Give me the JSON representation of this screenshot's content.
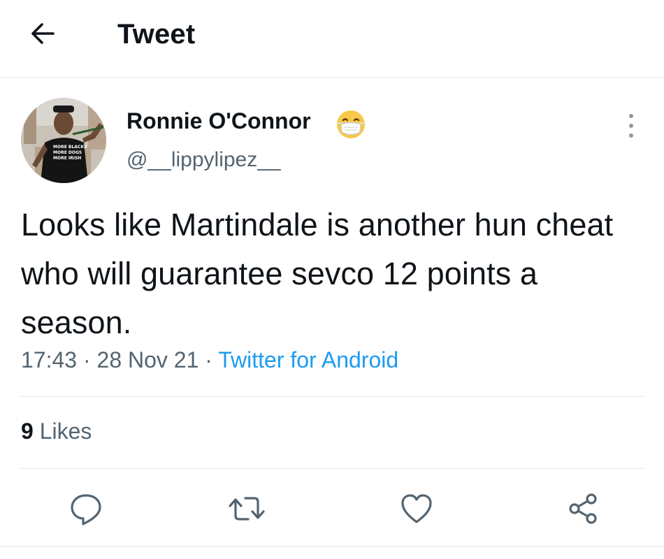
{
  "header": {
    "title": "Tweet",
    "back_icon": "arrow-left-icon"
  },
  "tweet": {
    "author": {
      "display_name": "Ronnie O'Connor",
      "name_emoji": "face-with-medical-mask-icon",
      "handle": "@__lippylipez__",
      "avatar_shirt_text": [
        "MORE BLACKS",
        "MORE DOGS",
        "MORE IRISH"
      ]
    },
    "text": "Looks like Martindale is another hun cheat who will guarantee sevco 12 points a season.",
    "time": "17:43",
    "date": "28 Nov 21",
    "separator": "·",
    "source": "Twitter for Android",
    "likes": {
      "count": "9",
      "label": "Likes"
    }
  },
  "actions": [
    {
      "name": "reply-icon"
    },
    {
      "name": "retweet-icon"
    },
    {
      "name": "like-heart-icon"
    },
    {
      "name": "share-icon"
    }
  ],
  "colors": {
    "text_primary": "#0f1419",
    "text_secondary": "#536471",
    "link": "#1d9bf0",
    "divider": "#e1e8ed"
  }
}
